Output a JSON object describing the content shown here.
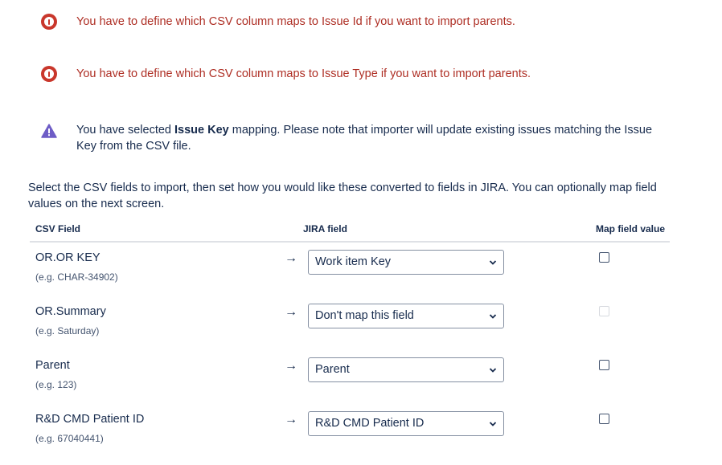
{
  "messages": [
    {
      "type": "error",
      "text": "You have to define which CSV column maps to Issue Id if you want to import parents."
    },
    {
      "type": "error",
      "text": "You have to define which CSV column maps to Issue Type if you want to import parents."
    },
    {
      "type": "warning",
      "prefix": "You have selected ",
      "bold": "Issue Key",
      "suffix": " mapping. Please note that importer will update existing issues matching the Issue Key from the CSV file."
    }
  ],
  "intro": "Select the CSV fields to import, then set how you would like these converted to fields in JIRA. You can optionally map field values on the next screen.",
  "table": {
    "headers": {
      "csv_field": "CSV Field",
      "jira_field": "JIRA field",
      "map_value": "Map field value"
    },
    "rows": [
      {
        "name": "OR.OR KEY",
        "example": "(e.g. CHAR-34902)",
        "arrow": "→",
        "jira_field": "Work item Key",
        "map_value_enabled": true
      },
      {
        "name": "OR.Summary",
        "example": "(e.g. Saturday)",
        "arrow": "→",
        "jira_field": "Don't map this field",
        "map_value_enabled": false
      },
      {
        "name": "Parent",
        "example": "(e.g. 123)",
        "arrow": "→",
        "jira_field": "Parent",
        "map_value_enabled": true
      },
      {
        "name": "R&D CMD Patient ID",
        "example": "(e.g. 67040441)",
        "arrow": "→",
        "jira_field": "R&D CMD Patient ID",
        "map_value_enabled": true
      }
    ]
  },
  "colors": {
    "error": "#c9372c",
    "error_text": "#ae2e24",
    "warning": "#6e5dc6"
  }
}
